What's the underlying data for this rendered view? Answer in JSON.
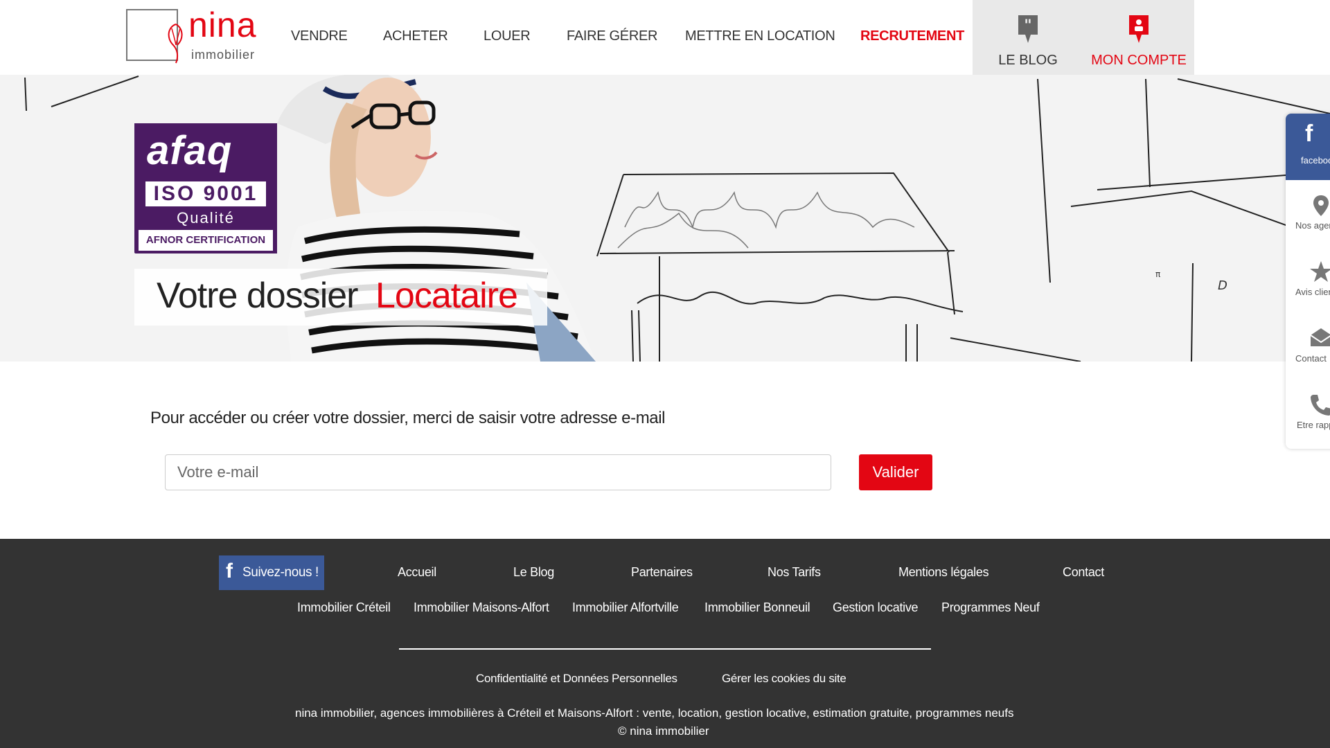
{
  "brand": {
    "name": "nina",
    "sub": "immobilier",
    "red": "#e30613",
    "purple": "#4b1b63",
    "fb_blue": "#3b5998"
  },
  "nav": {
    "items": [
      "VENDRE",
      "ACHETER",
      "LOUER",
      "FAIRE GÉRER",
      "METTRE EN LOCATION",
      "RECRUTEMENT"
    ],
    "blog": "LE BLOG",
    "account": "MON COMPTE"
  },
  "hero": {
    "badge": {
      "afaq": "afaq",
      "iso": "ISO 9001",
      "qualite": "Qualité",
      "afnor": "AFNOR CERTIFICATION"
    },
    "title_part1": "Votre dossier",
    "title_part2": "Locataire"
  },
  "sidebar": {
    "items": [
      "facebook",
      "Nos agences",
      "Avis clients",
      "Contact",
      "Etre rappelé"
    ]
  },
  "form": {
    "instruction": "Pour accéder ou créer votre dossier, merci de saisir votre adresse e-mail",
    "email_placeholder": "Votre e-mail",
    "email_value": "",
    "submit": "Valider"
  },
  "footer": {
    "follow": "Suivez-nous !",
    "links_row1": [
      "Accueil",
      "Le Blog",
      "Partenaires",
      "Nos Tarifs",
      "Mentions légales",
      "Contact"
    ],
    "links_row2": [
      "Immobilier Créteil",
      "Immobilier Maisons-Alfort",
      "Immobilier Alfortville",
      "Immobilier Bonneuil",
      "Gestion locative",
      "Programmes Neuf"
    ],
    "privacy": "Confidentialité et Données Personnelles",
    "cookies": "Gérer les cookies du site",
    "description": "nina immobilier, agences immobilières à Créteil et Maisons-Alfort : vente, location, gestion locative, estimation gratuite, programmes neufs",
    "copyright": "© nina immobilier"
  }
}
